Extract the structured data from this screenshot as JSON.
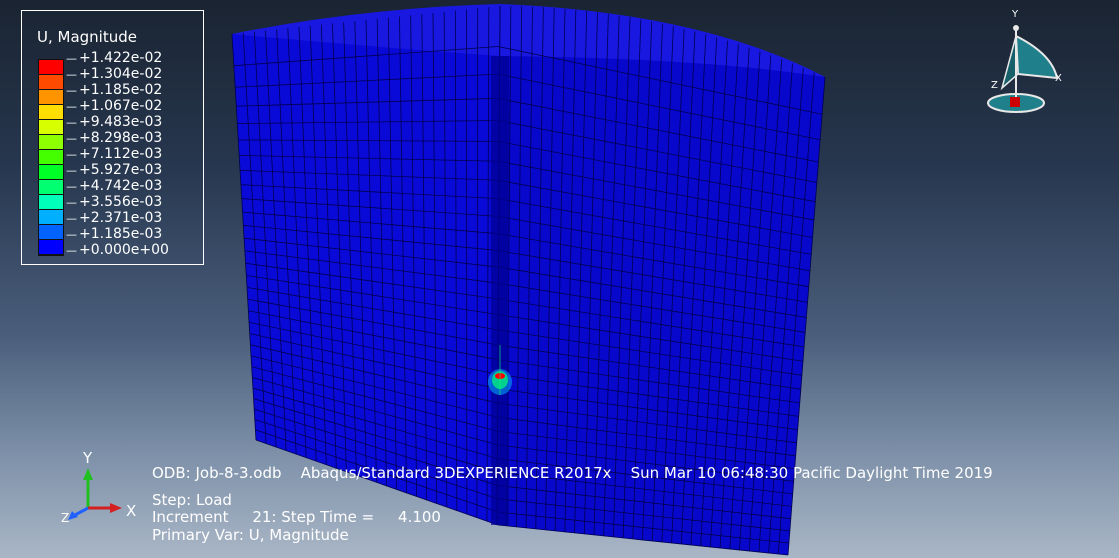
{
  "legend": {
    "title": "U, Magnitude",
    "values": [
      "+1.422e-02",
      "+1.304e-02",
      "+1.185e-02",
      "+1.067e-02",
      "+9.483e-03",
      "+8.298e-03",
      "+7.112e-03",
      "+5.927e-03",
      "+4.742e-03",
      "+3.556e-03",
      "+2.371e-03",
      "+1.185e-03",
      "+0.000e+00"
    ],
    "colors": [
      "#ff0000",
      "#ff4a00",
      "#ff9400",
      "#ffde00",
      "#d7ff00",
      "#8dff00",
      "#43ff00",
      "#00ff27",
      "#00ff71",
      "#00ffbb",
      "#00b0ff",
      "#0062ff",
      "#0000ff"
    ]
  },
  "info": {
    "odb_line": "ODB: Job-8-3.odb    Abaqus/Standard 3DEXPERIENCE R2017x    Sun Mar 10 06:48:30 Pacific Daylight Time 2019",
    "step_line": "Step: Load",
    "increment_line": "Increment     21: Step Time =     4.100",
    "primary_var_line": "Primary Var: U, Magnitude"
  },
  "triad": {
    "x_label": "X",
    "y_label": "Y",
    "z_label": "Z",
    "x_color": "#d42020",
    "y_color": "#20c020",
    "z_color": "#2060ff"
  },
  "compass": {
    "x_label": "X",
    "y_label": "Y",
    "z_label": "Z"
  },
  "model": {
    "face_color": "#0a0ad8",
    "mesh_color": "#000050",
    "hotspot_colors": [
      "#ff0000",
      "#00ff71",
      "#00b0ff"
    ]
  }
}
